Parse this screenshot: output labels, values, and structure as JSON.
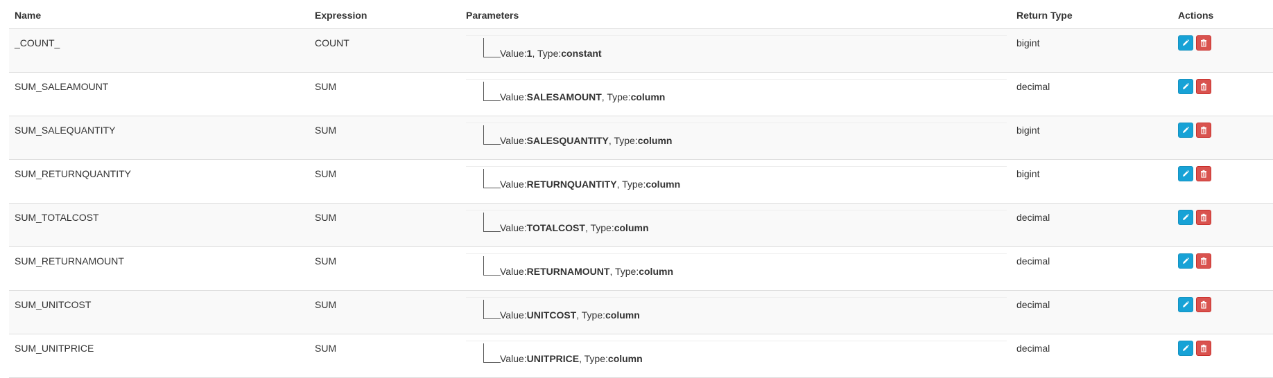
{
  "columns": {
    "name": "Name",
    "expression": "Expression",
    "parameters": "Parameters",
    "return_type": "Return Type",
    "actions": "Actions"
  },
  "param_labels": {
    "value": "Value:",
    "sep": ", ",
    "type": "Type:"
  },
  "rows": [
    {
      "name": "_COUNT_",
      "expression": "COUNT",
      "value": "1",
      "type": "constant",
      "return_type": "bigint"
    },
    {
      "name": "SUM_SALEAMOUNT",
      "expression": "SUM",
      "value": "SALESAMOUNT",
      "type": "column",
      "return_type": "decimal"
    },
    {
      "name": "SUM_SALEQUANTITY",
      "expression": "SUM",
      "value": "SALESQUANTITY",
      "type": "column",
      "return_type": "bigint"
    },
    {
      "name": "SUM_RETURNQUANTITY",
      "expression": "SUM",
      "value": "RETURNQUANTITY",
      "type": "column",
      "return_type": "bigint"
    },
    {
      "name": "SUM_TOTALCOST",
      "expression": "SUM",
      "value": "TOTALCOST",
      "type": "column",
      "return_type": "decimal"
    },
    {
      "name": "SUM_RETURNAMOUNT",
      "expression": "SUM",
      "value": "RETURNAMOUNT",
      "type": "column",
      "return_type": "decimal"
    },
    {
      "name": "SUM_UNITCOST",
      "expression": "SUM",
      "value": "UNITCOST",
      "type": "column",
      "return_type": "decimal"
    },
    {
      "name": "SUM_UNITPRICE",
      "expression": "SUM",
      "value": "UNITPRICE",
      "type": "column",
      "return_type": "decimal"
    }
  ],
  "icons": {
    "edit": "pencil-icon",
    "delete": "trash-icon"
  },
  "colors": {
    "edit_button": "#17a2d6",
    "delete_button": "#d9534f",
    "row_striped": "#f9f9f9"
  }
}
